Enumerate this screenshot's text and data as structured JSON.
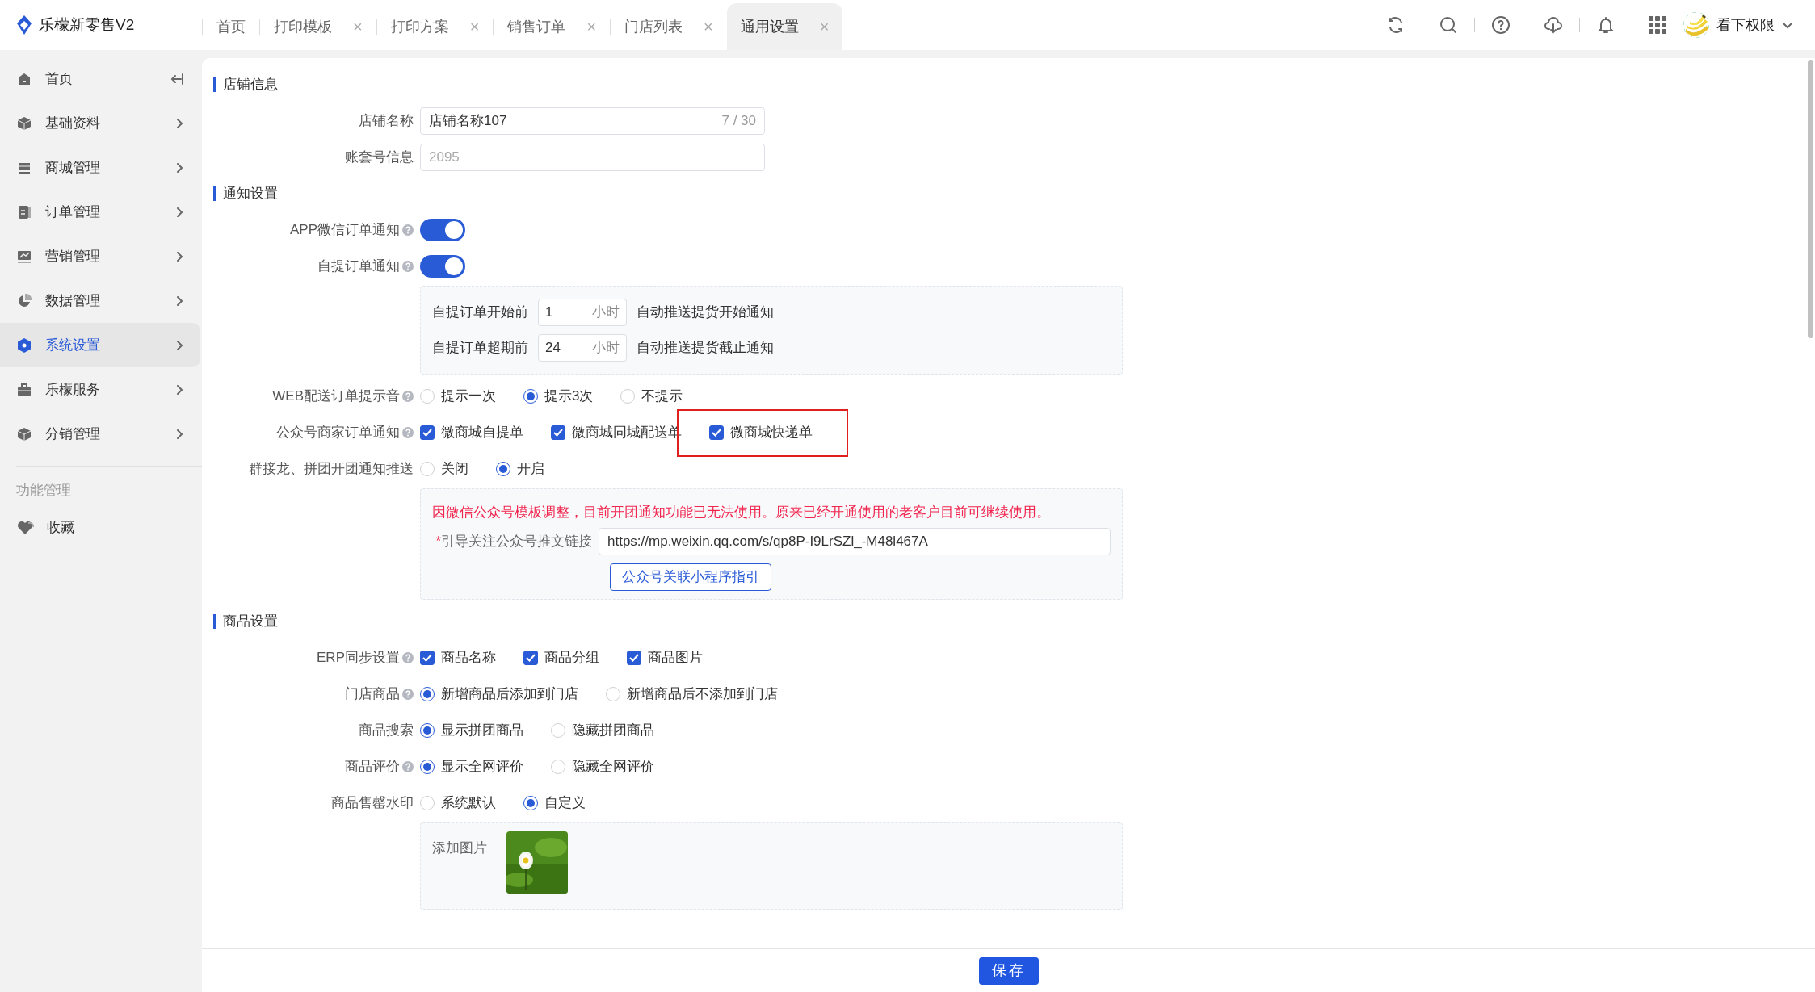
{
  "app": {
    "title": "乐檬新零售V2"
  },
  "tabs": [
    {
      "label": "首页",
      "selected": false
    },
    {
      "label": "打印模板",
      "close": "×",
      "selected": false
    },
    {
      "label": "打印方案",
      "close": "×",
      "selected": false
    },
    {
      "label": "销售订单",
      "close": "×",
      "selected": false
    },
    {
      "label": "门店列表",
      "close": "×",
      "selected": false
    },
    {
      "label": "通用设置",
      "close": "×",
      "selected": true
    }
  ],
  "user": {
    "name": "看下权限"
  },
  "sidebar": {
    "items": [
      {
        "label": "首页",
        "kind": "collapse",
        "selected": false
      },
      {
        "label": "基础资料",
        "kind": "submenu",
        "selected": false
      },
      {
        "label": "商城管理",
        "kind": "submenu",
        "selected": false
      },
      {
        "label": "订单管理",
        "kind": "submenu",
        "selected": false
      },
      {
        "label": "营销管理",
        "kind": "submenu",
        "selected": false
      },
      {
        "label": "数据管理",
        "kind": "submenu",
        "selected": false
      },
      {
        "label": "系统设置",
        "kind": "submenu",
        "selected": true
      },
      {
        "label": "乐檬服务",
        "kind": "submenu",
        "selected": false
      },
      {
        "label": "分销管理",
        "kind": "submenu",
        "selected": false
      }
    ],
    "group_title": "功能管理",
    "favorites": [
      {
        "label": "收藏"
      }
    ]
  },
  "sections": [
    {
      "title": "店铺信息",
      "rows": [
        {
          "kind": "text",
          "label": "店铺名称",
          "value": "店铺名称107",
          "counter": "7 / 30",
          "disabled": false
        },
        {
          "kind": "text",
          "label": "账套号信息",
          "value": "2095",
          "disabled": true
        }
      ]
    },
    {
      "title": "通知设置",
      "rows": [
        {
          "kind": "switch",
          "label": "APP微信订单通知",
          "help": true,
          "on": true
        },
        {
          "kind": "switch",
          "label": "自提订单通知",
          "help": true,
          "on": true
        },
        {
          "kind": "hours",
          "lines": [
            {
              "label": "自提订单开始前",
              "value": "1",
              "unit": "小时",
              "note": "自动推送提货开始通知"
            },
            {
              "label": "自提订单超期前",
              "value": "24",
              "unit": "小时",
              "note": "自动推送提货截止通知"
            }
          ]
        },
        {
          "kind": "radio",
          "label": "WEB配送订单提示音",
          "help": true,
          "options": [
            {
              "label": "提示一次",
              "selected": false
            },
            {
              "label": "提示3次",
              "selected": true
            },
            {
              "label": "不提示",
              "selected": false
            }
          ]
        },
        {
          "kind": "checkbox",
          "label": "公众号商家订单通知",
          "help": true,
          "options": [
            {
              "label": "微商城自提单",
              "checked": true,
              "highlighted": false
            },
            {
              "label": "微商城同城配送单",
              "checked": true,
              "highlighted": false
            },
            {
              "label": "微商城快递单",
              "checked": true,
              "highlighted": true
            }
          ]
        },
        {
          "kind": "radio",
          "label": "群接龙、拼团开团通知推送",
          "help": false,
          "options": [
            {
              "label": "关闭",
              "selected": false
            },
            {
              "label": "开启",
              "selected": true
            }
          ]
        },
        {
          "kind": "notice",
          "warning": "因微信公众号模板调整，目前开团通知功能已无法使用。原来已经开通使用的老客户目前可继续使用。",
          "field_label": "引导关注公众号推文链接",
          "required_mark": "*",
          "value": "https://mp.weixin.qq.com/s/qp8P-I9LrSZl_-M48l467A",
          "button": "公众号关联小程序指引"
        }
      ]
    },
    {
      "title": "商品设置",
      "rows": [
        {
          "kind": "checkbox",
          "label": "ERP同步设置",
          "help": true,
          "options": [
            {
              "label": "商品名称",
              "checked": true,
              "highlighted": false
            },
            {
              "label": "商品分组",
              "checked": true,
              "highlighted": false
            },
            {
              "label": "商品图片",
              "checked": true,
              "highlighted": false
            }
          ]
        },
        {
          "kind": "radio",
          "label": "门店商品",
          "help": true,
          "options": [
            {
              "label": "新增商品后添加到门店",
              "selected": true
            },
            {
              "label": "新增商品后不添加到门店",
              "selected": false
            }
          ]
        },
        {
          "kind": "radio",
          "label": "商品搜索",
          "help": false,
          "options": [
            {
              "label": "显示拼团商品",
              "selected": true
            },
            {
              "label": "隐藏拼团商品",
              "selected": false
            }
          ]
        },
        {
          "kind": "radio",
          "label": "商品评价",
          "help": true,
          "options": [
            {
              "label": "显示全网评价",
              "selected": true
            },
            {
              "label": "隐藏全网评价",
              "selected": false
            }
          ]
        },
        {
          "kind": "radio",
          "label": "商品售罄水印",
          "help": false,
          "options": [
            {
              "label": "系统默认",
              "selected": false
            },
            {
              "label": "自定义",
              "selected": true
            }
          ]
        },
        {
          "label": "添加图片"
        }
      ]
    }
  ],
  "footer": {
    "save": "保存"
  }
}
